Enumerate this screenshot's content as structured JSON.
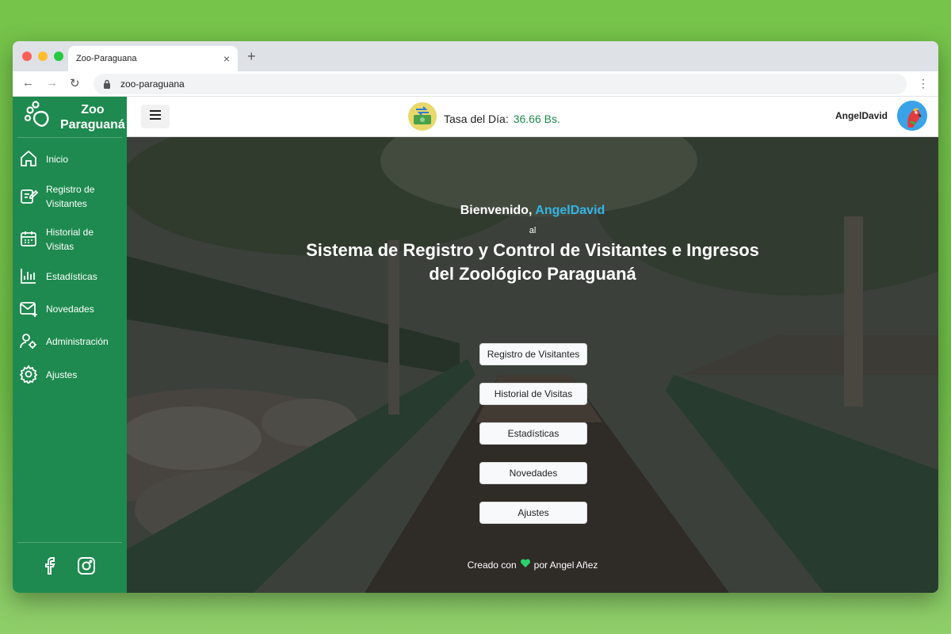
{
  "browser": {
    "tab_title": "Zoo-Paraguana",
    "url": "zoo-paraguana"
  },
  "sidebar": {
    "brand_line1": "Zoo",
    "brand_line2": "Paraguaná",
    "items": [
      {
        "label": "Inicio",
        "icon": "home-icon"
      },
      {
        "label": "Registro de Visitantes",
        "icon": "edit-icon"
      },
      {
        "label": "Historial de Visitas",
        "icon": "calendar-icon"
      },
      {
        "label": "Estadísticas",
        "icon": "bar-chart-icon"
      },
      {
        "label": "Novedades",
        "icon": "mail-icon"
      },
      {
        "label": "Administración",
        "icon": "user-gear-icon"
      },
      {
        "label": "Ajustes",
        "icon": "gear-icon"
      }
    ],
    "social": [
      "facebook-icon",
      "instagram-icon"
    ]
  },
  "topbar": {
    "rate_label": "Tasa del Día:",
    "rate_value": "36.66 Bs.",
    "username": "AngelDavid"
  },
  "hero": {
    "welcome_prefix": "Bienvenido,",
    "welcome_user": "AngelDavid",
    "al": "al",
    "headline_line1": "Sistema de Registro y Control de Visitantes e Ingresos",
    "headline_line2": "del Zoológico Paraguaná",
    "buttons": [
      "Registro de Visitantes",
      "Historial de Visitas",
      "Estadísticas",
      "Novedades",
      "Ajustes"
    ],
    "footer_prefix": "Creado con",
    "footer_suffix": "por Angel Añez"
  },
  "colors": {
    "brand_green": "#1e8a4f",
    "accent_blue": "#33b4e6"
  }
}
